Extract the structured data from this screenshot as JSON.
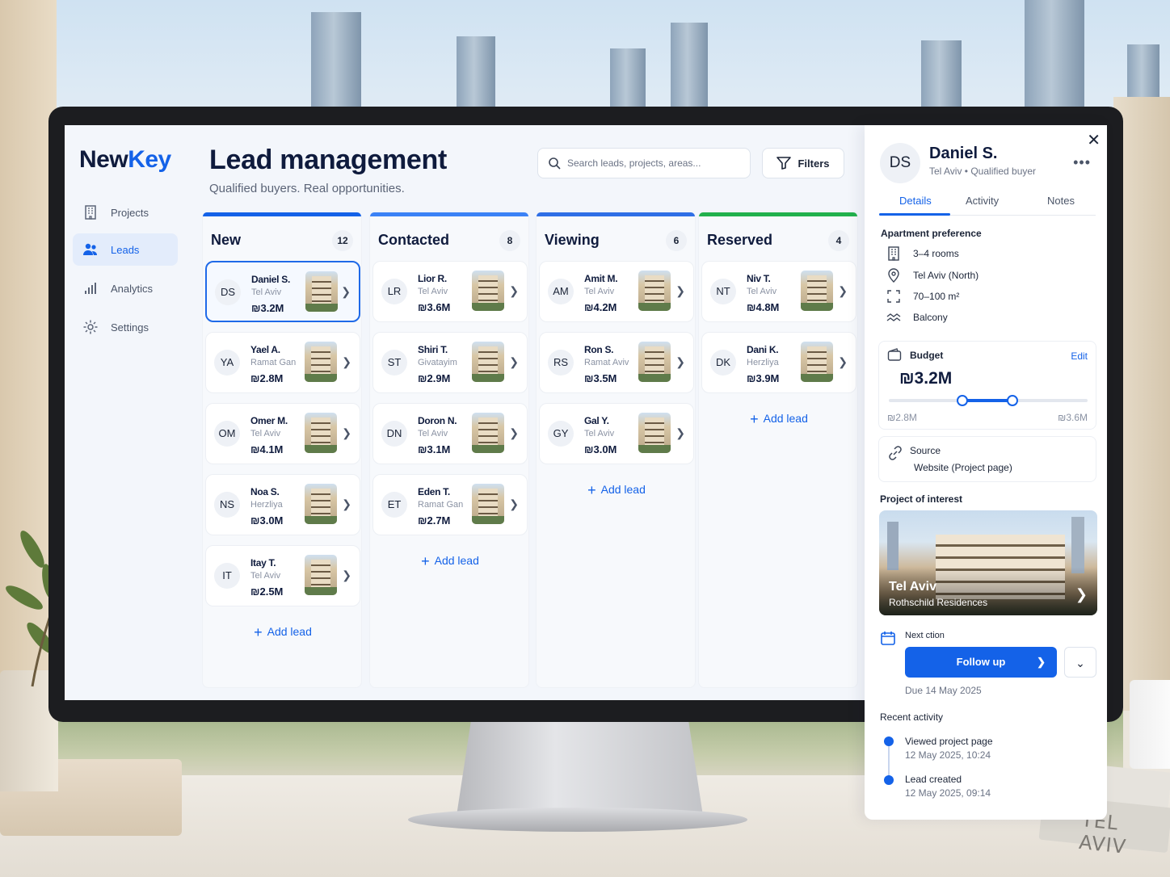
{
  "sidebar": {
    "logo_new": "New",
    "logo_key": "Key",
    "items": [
      {
        "label": "Projects",
        "icon": "building-icon"
      },
      {
        "label": "Leads",
        "icon": "users-icon"
      },
      {
        "label": "Analytics",
        "icon": "bar-chart-icon"
      },
      {
        "label": "Settings",
        "icon": "gear-icon"
      }
    ],
    "active": "Leads"
  },
  "header": {
    "title": "Lead management",
    "subtitle": "Qualified buyers. Real opportunities.",
    "search_placeholder": "Search leads, projects, areas...",
    "filters_label": "Filters"
  },
  "columns": [
    {
      "title": "New",
      "count": "12",
      "accent": "#1462e8",
      "cards": [
        {
          "initials": "DS",
          "name": "Daniel S.",
          "city": "Tel Aviv",
          "price": "₪3.2M",
          "selected": true
        },
        {
          "initials": "YA",
          "name": "Yael A.",
          "city": "Ramat Gan",
          "price": "₪2.8M"
        },
        {
          "initials": "OM",
          "name": "Omer M.",
          "city": "Tel Aviv",
          "price": "₪4.1M"
        },
        {
          "initials": "NS",
          "name": "Noa S.",
          "city": "Herzliya",
          "price": "₪3.0M"
        },
        {
          "initials": "IT",
          "name": "Itay T.",
          "city": "Tel Aviv",
          "price": "₪2.5M"
        }
      ],
      "add_label": "Add lead"
    },
    {
      "title": "Contacted",
      "count": "8",
      "accent": "#3b82f6",
      "cards": [
        {
          "initials": "LR",
          "name": "Lior R.",
          "city": "Tel Aviv",
          "price": "₪3.6M"
        },
        {
          "initials": "ST",
          "name": "Shiri T.",
          "city": "Givatayim",
          "price": "₪2.9M"
        },
        {
          "initials": "DN",
          "name": "Doron N.",
          "city": "Tel Aviv",
          "price": "₪3.1M"
        },
        {
          "initials": "ET",
          "name": "Eden T.",
          "city": "Ramat Gan",
          "price": "₪2.7M"
        }
      ],
      "add_label": "Add lead"
    },
    {
      "title": "Viewing",
      "count": "6",
      "accent": "#2f6fe6",
      "cards": [
        {
          "initials": "AM",
          "name": "Amit M.",
          "city": "Tel Aviv",
          "price": "₪4.2M"
        },
        {
          "initials": "RS",
          "name": "Ron S.",
          "city": "Ramat Aviv",
          "price": "₪3.5M"
        },
        {
          "initials": "GY",
          "name": "Gal Y.",
          "city": "Tel Aviv",
          "price": "₪3.0M"
        }
      ],
      "add_label": "Add lead"
    },
    {
      "title": "Reserved",
      "count": "4",
      "accent": "#22b14c",
      "cards": [
        {
          "initials": "NT",
          "name": "Niv T.",
          "city": "Tel Aviv",
          "price": "₪4.8M"
        },
        {
          "initials": "DK",
          "name": "Dani K.",
          "city": "Herzliya",
          "price": "₪3.9M"
        }
      ],
      "add_label": "Add lead"
    }
  ],
  "detail": {
    "initials": "DS",
    "name": "Daniel S.",
    "city": "Tel Aviv",
    "status": "Qualified buyer",
    "tabs": [
      "Details",
      "Activity",
      "Notes"
    ],
    "active_tab": "Details",
    "preference_title": "Apartment preference",
    "preferences": [
      {
        "icon": "building-icon",
        "text": "3–4 rooms"
      },
      {
        "icon": "location-pin-icon",
        "text": "Tel Aviv (North)"
      },
      {
        "icon": "expand-icon",
        "text": "70–100 m²"
      },
      {
        "icon": "balcony-icon",
        "text": "Balcony"
      }
    ],
    "budget_title": "Budget",
    "budget_edit": "Edit",
    "budget_value": "₪3.2M",
    "budget_min": "₪2.8M",
    "budget_max": "₪3.6M",
    "budget_range_fraction": [
      0.37,
      0.62
    ],
    "source_title": "Source",
    "source_value": "Website (Project page)",
    "project_title": "Project of interest",
    "project_city": "Tel Aviv",
    "project_name": "Rothschild Residences",
    "next_action_label": "Next ction",
    "next_action_button": "Follow up",
    "due": "Due 14 May 2025",
    "recent_title": "Recent activity",
    "activity": [
      {
        "title": "Viewed project page",
        "time": "12 May 2025, 10:24"
      },
      {
        "title": "Lead created",
        "time": "12 May 2025, 09:14"
      }
    ]
  },
  "scene": {
    "book_text": "TEL AVIV"
  }
}
